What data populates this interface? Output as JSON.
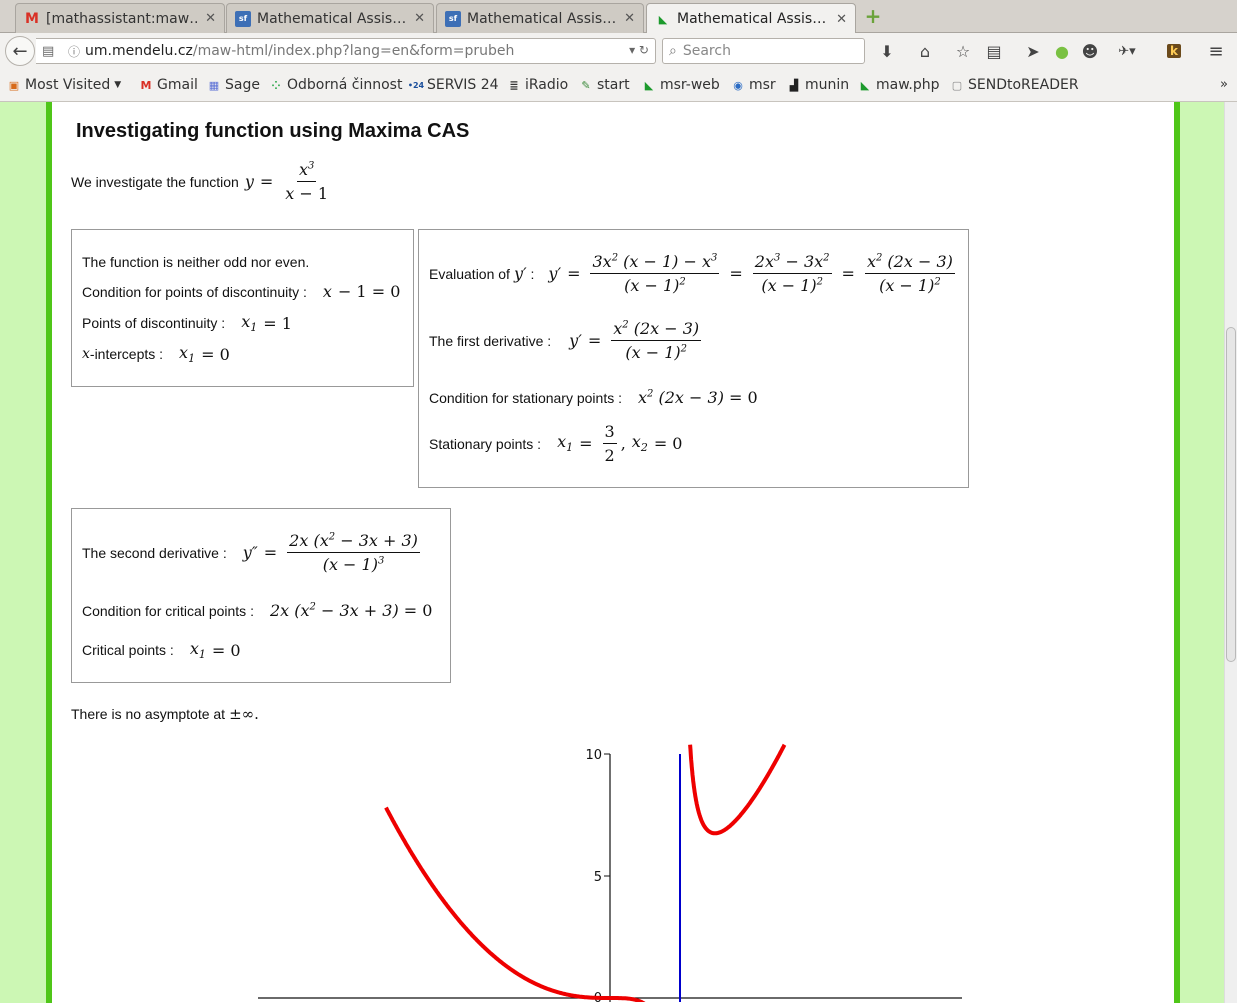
{
  "tabs": [
    {
      "label": "[mathassistant:maw…",
      "icon": "gmail-icon"
    },
    {
      "label": "Mathematical Assis…",
      "icon": "sf-icon"
    },
    {
      "label": "Mathematical Assis…",
      "icon": "sf-icon"
    },
    {
      "label": "Mathematical Assis…",
      "icon": "maw-icon",
      "active": true
    }
  ],
  "nav": {
    "url_domain": "um.mendelu.cz",
    "url_path": "/maw-html/index.php?lang=en&form=prubeh",
    "search_placeholder": "Search"
  },
  "bookmarks": [
    "Most Visited",
    "Gmail",
    "Sage",
    "Odborná činnost",
    "SERVIS 24",
    "iRadio",
    "start",
    "msr-web",
    "msr",
    "munin",
    "maw.php",
    "SENDtoREADER"
  ],
  "page": {
    "heading": "Investigating function using Maxima CAS",
    "intro": "We investigate the function",
    "box1": {
      "parity": "The function is neither odd nor even.",
      "disc_cond": "Condition for points of discontinuity :",
      "disc_points": "Points of discontinuity :",
      "intercepts": "-intercepts :"
    },
    "box2": {
      "evaluation": "Evaluation of",
      "first_derivative": "The first derivative :",
      "stationary_cond": "Condition for stationary points :",
      "stationary_points": "Stationary points :"
    },
    "box3": {
      "second_derivative": "The second derivative :",
      "critical_cond": "Condition for critical points :",
      "critical_points": "Critical points :"
    },
    "asymptote": "There is no asymptote at",
    "asymptote_sym": "±∞."
  },
  "chart_data": {
    "type": "line",
    "y_ticks": [
      "10",
      "5",
      "0"
    ],
    "series_color": "#ee0000",
    "asymptote_color": "#0000cc"
  }
}
